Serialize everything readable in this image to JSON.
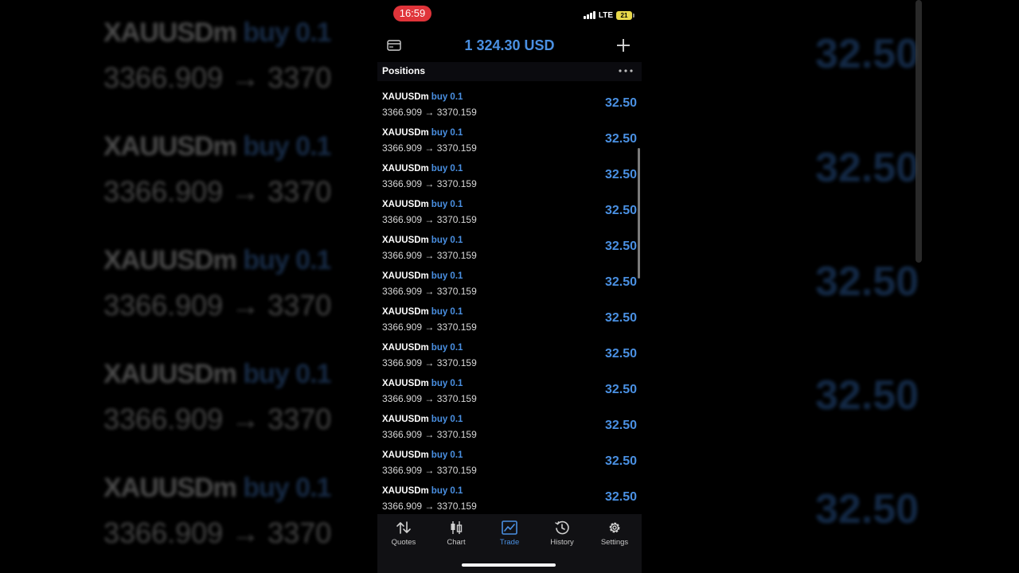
{
  "status_bar": {
    "time": "16:59",
    "network": "LTE",
    "battery": "21"
  },
  "header": {
    "balance": "1 324.30 USD"
  },
  "positions": {
    "title": "Positions",
    "rows": [
      {
        "symbol": "XAUUSDm",
        "type": "buy 0.1",
        "prices": "3366.909 → 3370.159",
        "profit": "32.50"
      },
      {
        "symbol": "XAUUSDm",
        "type": "buy 0.1",
        "prices": "3366.909 → 3370.159",
        "profit": "32.50"
      },
      {
        "symbol": "XAUUSDm",
        "type": "buy 0.1",
        "prices": "3366.909 → 3370.159",
        "profit": "32.50"
      },
      {
        "symbol": "XAUUSDm",
        "type": "buy 0.1",
        "prices": "3366.909 → 3370.159",
        "profit": "32.50"
      },
      {
        "symbol": "XAUUSDm",
        "type": "buy 0.1",
        "prices": "3366.909 → 3370.159",
        "profit": "32.50"
      },
      {
        "symbol": "XAUUSDm",
        "type": "buy 0.1",
        "prices": "3366.909 → 3370.159",
        "profit": "32.50"
      },
      {
        "symbol": "XAUUSDm",
        "type": "buy 0.1",
        "prices": "3366.909 → 3370.159",
        "profit": "32.50"
      },
      {
        "symbol": "XAUUSDm",
        "type": "buy 0.1",
        "prices": "3366.909 → 3370.159",
        "profit": "32.50"
      },
      {
        "symbol": "XAUUSDm",
        "type": "buy 0.1",
        "prices": "3366.909 → 3370.159",
        "profit": "32.50"
      },
      {
        "symbol": "XAUUSDm",
        "type": "buy 0.1",
        "prices": "3366.909 → 3370.159",
        "profit": "32.50"
      },
      {
        "symbol": "XAUUSDm",
        "type": "buy 0.1",
        "prices": "3366.909 → 3370.159",
        "profit": "32.50"
      },
      {
        "symbol": "XAUUSDm",
        "type": "buy 0.1",
        "prices": "3366.909 → 3370.159",
        "profit": "32.50"
      }
    ]
  },
  "tabs": [
    {
      "label": "Quotes",
      "icon": "quotes-icon"
    },
    {
      "label": "Chart",
      "icon": "chart-icon"
    },
    {
      "label": "Trade",
      "icon": "trade-icon"
    },
    {
      "label": "History",
      "icon": "history-icon"
    },
    {
      "label": "Settings",
      "icon": "settings-icon"
    }
  ],
  "background_text": {
    "title_symbol": "XAUUSDm",
    "title_type": "buy 0.1",
    "prices": "3366.909 → 3370",
    "profit": "32.50"
  },
  "colors": {
    "accent": "#4a90e2",
    "background": "#000000",
    "time_pill": "#e0343a",
    "battery": "#e8d84a"
  }
}
